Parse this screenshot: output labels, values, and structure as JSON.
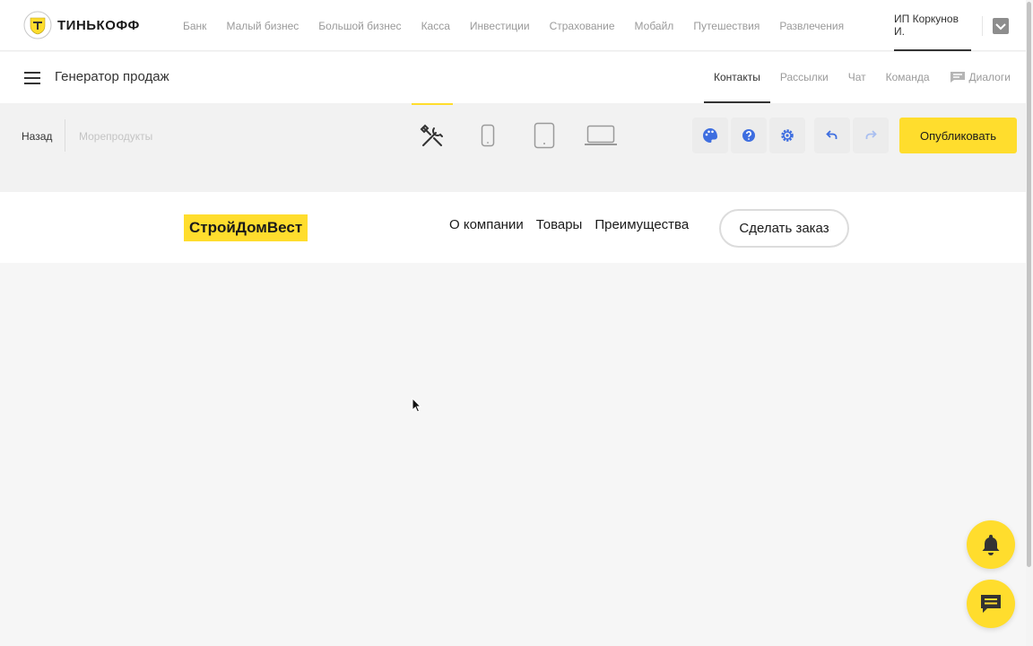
{
  "brand": {
    "name": "ТИНЬКОФФ",
    "icon": "tinkoff-shield-icon"
  },
  "top_nav": [
    "Банк",
    "Малый бизнес",
    "Большой бизнес",
    "Касса",
    "Инвестиции",
    "Страхование",
    "Мобайл",
    "Путешествия",
    "Развлечения"
  ],
  "user": {
    "name": "ИП Коркунов И.",
    "menu_icon": "chevron-down-icon"
  },
  "app": {
    "title": "Генератор продаж",
    "tabs": [
      {
        "label": "Контакты",
        "active": true
      },
      {
        "label": "Рассылки",
        "active": false
      },
      {
        "label": "Чат",
        "active": false
      },
      {
        "label": "Команда",
        "active": false
      },
      {
        "label": "Диалоги",
        "active": false,
        "icon": "chat-icon"
      }
    ]
  },
  "toolbar": {
    "back_label": "Назад",
    "site_name": "Морепродукты",
    "devices": [
      {
        "icon": "tools-icon",
        "active": true
      },
      {
        "icon": "mobile-icon",
        "active": false
      },
      {
        "icon": "tablet-icon",
        "active": false
      },
      {
        "icon": "laptop-icon",
        "active": false
      }
    ],
    "actions": [
      "palette-icon",
      "help-icon",
      "settings-icon",
      "undo-icon",
      "redo-icon"
    ],
    "publish_label": "Опубликовать"
  },
  "site": {
    "brand": "СтройДомВест",
    "nav": [
      "О компании",
      "Товары",
      "Преимущества"
    ],
    "cta_label": "Сделать заказ"
  },
  "floating": [
    "bell-icon",
    "chat-icon"
  ],
  "colors": {
    "accent": "#ffdd2d",
    "icon_blue": "#3e6ee0",
    "text": "#333333",
    "muted": "#9a9a9a"
  }
}
